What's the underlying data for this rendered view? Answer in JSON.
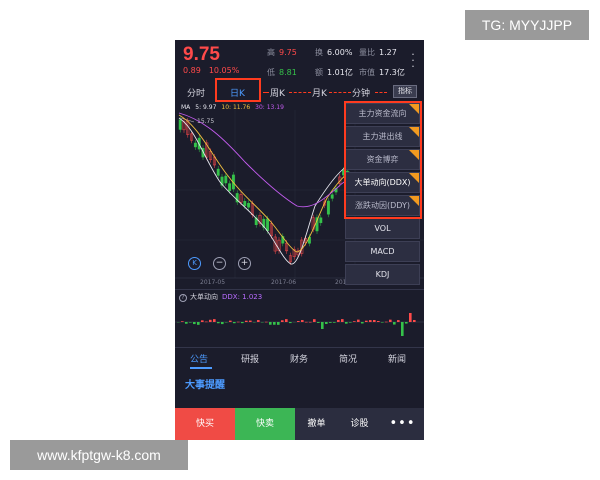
{
  "watermarks": {
    "top": "TG: MYYJJPP",
    "bottom": "www.kfptgw-k8.com"
  },
  "quote": {
    "price": "9.75",
    "change": "0.89",
    "change_pct": "10.05%",
    "stats": [
      {
        "label": "高",
        "value": "9.75",
        "color": "red"
      },
      {
        "label": "换",
        "value": "6.00%",
        "color": "white"
      },
      {
        "label": "量比",
        "value": "1.27",
        "color": "white"
      },
      {
        "label": "低",
        "value": "8.81",
        "color": "green"
      },
      {
        "label": "额",
        "value": "1.01亿",
        "color": "white"
      },
      {
        "label": "市值",
        "value": "17.3亿",
        "color": "white"
      }
    ]
  },
  "period_tabs": [
    {
      "label": "分时",
      "active": false
    },
    {
      "label": "日K",
      "active": true
    },
    {
      "label": "周K",
      "active": false
    },
    {
      "label": "月K",
      "active": false
    },
    {
      "label": "分钟",
      "active": false
    }
  ],
  "indicator_button": "指标",
  "ma_legend": {
    "prefix": "MA",
    "items": [
      {
        "text": "5: 9.97",
        "color": "#e6e6ee"
      },
      {
        "text": "10: 11.76",
        "color": "#f0c040"
      },
      {
        "text": "30: 13.19",
        "color": "#c45cf0"
      }
    ]
  },
  "chart_label": "15.75",
  "chart_dates": [
    "2017-05",
    "2017-06",
    "2017"
  ],
  "chart_controls": {
    "k": "K",
    "minus": "−",
    "plus": "+"
  },
  "indicator_menu": [
    {
      "label": "主力资金流向",
      "premium": true,
      "highlight": false
    },
    {
      "label": "主力进出线",
      "premium": true,
      "highlight": false
    },
    {
      "label": "资金博弈",
      "premium": true,
      "highlight": false
    },
    {
      "label": "大单动向(DDX)",
      "premium": true,
      "highlight": true
    },
    {
      "label": "涨跌动因(DDY)",
      "premium": true,
      "highlight": false
    },
    {
      "label": "VOL",
      "premium": false,
      "highlight": false
    },
    {
      "label": "MACD",
      "premium": false,
      "highlight": false
    },
    {
      "label": "KDJ",
      "premium": false,
      "highlight": false
    }
  ],
  "sub_chart": {
    "help": "?",
    "name": "大单动向",
    "ddx": "DDX: 1.023"
  },
  "info_tabs": [
    {
      "label": "公告",
      "active": true
    },
    {
      "label": "研报",
      "active": false
    },
    {
      "label": "财务",
      "active": false
    },
    {
      "label": "简况",
      "active": false
    },
    {
      "label": "新闻",
      "active": false
    }
  ],
  "events_title": "大事提醒",
  "bottom_bar": {
    "buy": "快买",
    "sell": "快卖",
    "cancel": "撤单",
    "diagnose": "诊股",
    "more": "•••"
  },
  "colors": {
    "up": "#ff4a4a",
    "down": "#35c24a",
    "accent": "#4d9bff",
    "highlight_box": "#ff3b1f",
    "premium_corner": "#f29a1f",
    "background": "#1b1c2b"
  }
}
